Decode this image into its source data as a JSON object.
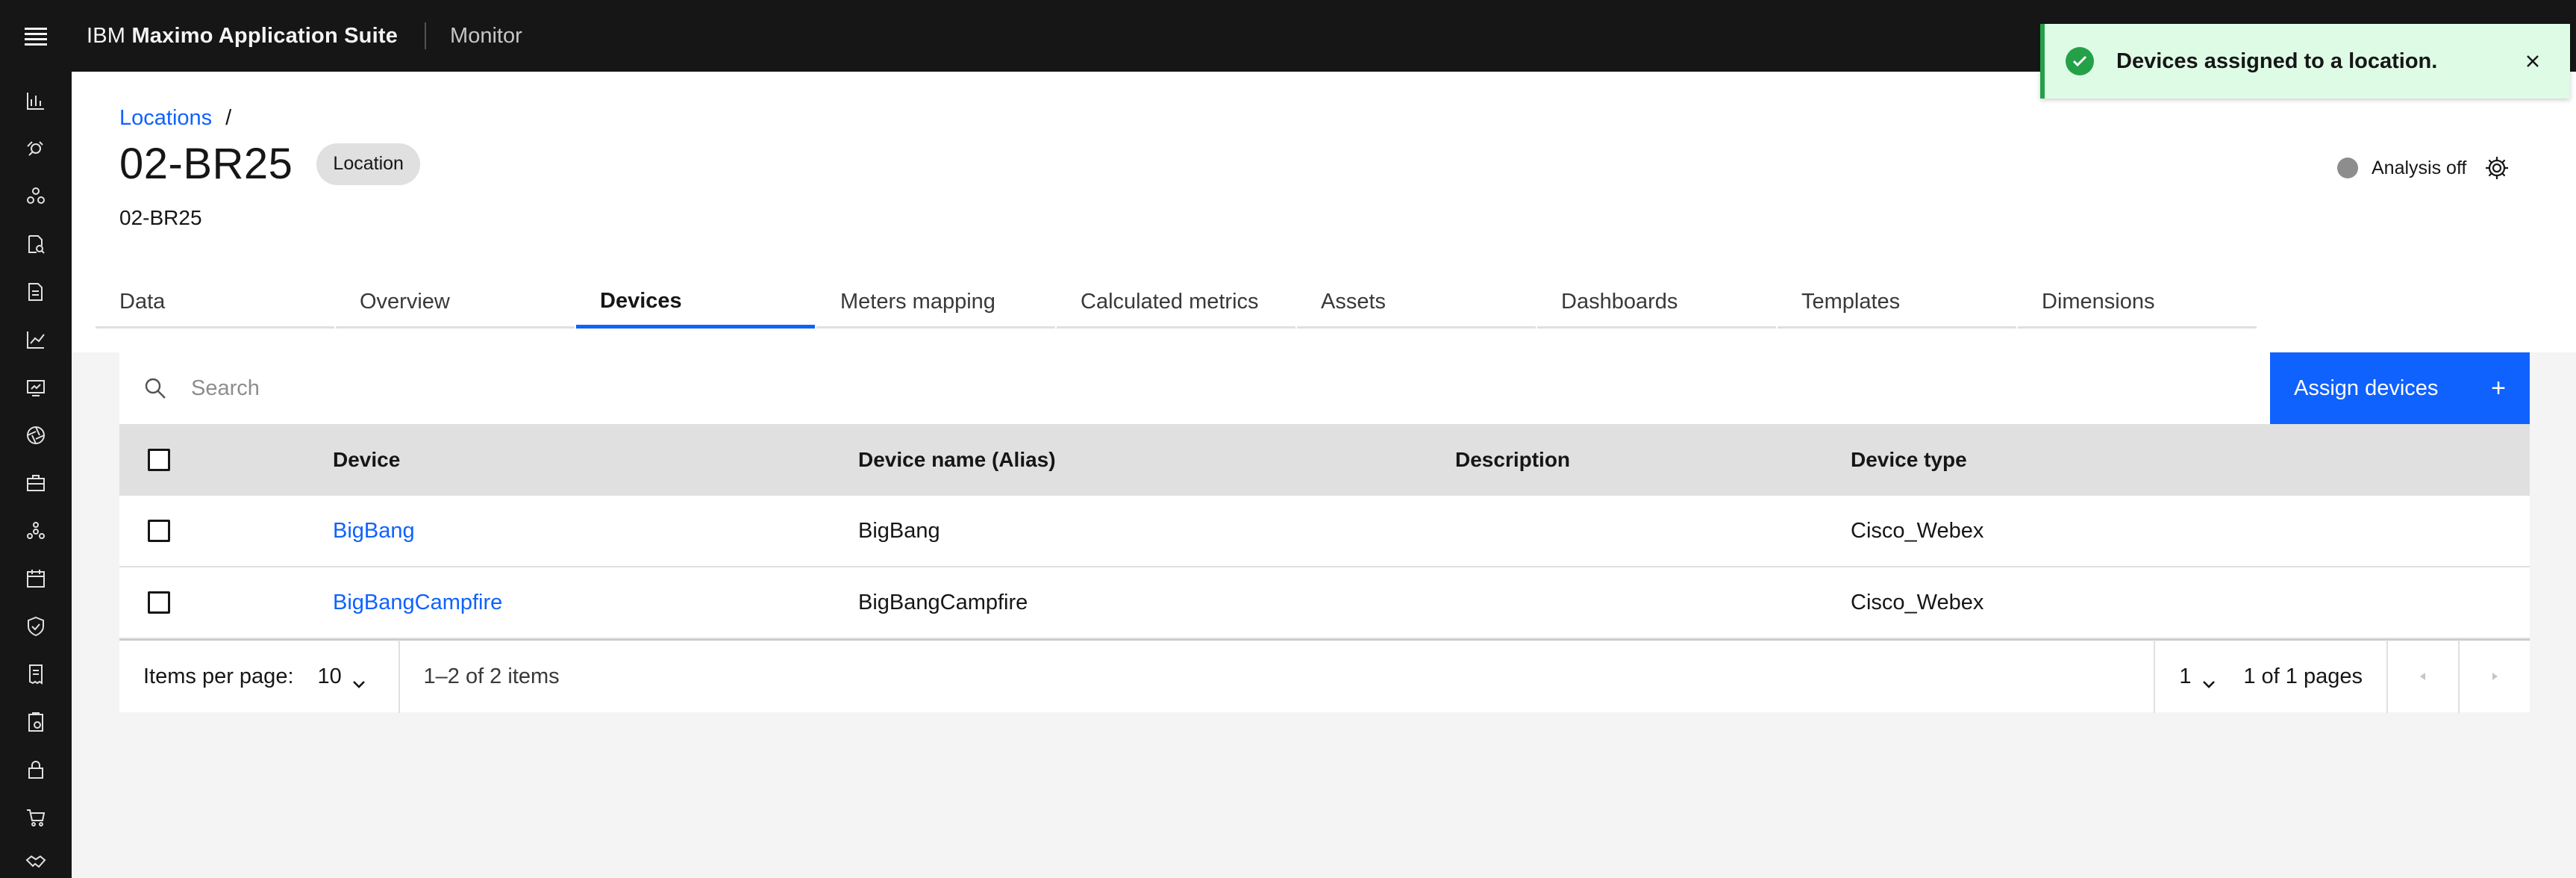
{
  "header": {
    "brand_prefix": "IBM",
    "brand_name": "Maximo Application Suite",
    "product": "Monitor"
  },
  "rail": {
    "icons": [
      "bar-chart-icon",
      "satellite-icon",
      "network-icon",
      "document-search-icon",
      "report-icon",
      "line-chart-icon",
      "screen-icon",
      "aperture-icon",
      "briefcase-icon",
      "hierarchy-icon",
      "calendar-icon",
      "shield-icon",
      "receipt-icon",
      "clipboard-icon",
      "lock-icon",
      "cart-icon",
      "handshake-icon"
    ]
  },
  "breadcrumb": {
    "link": "Locations",
    "separator": "/"
  },
  "page": {
    "title": "02-BR25",
    "tag": "Location",
    "subtitle": "02-BR25"
  },
  "analysis": {
    "label": "Analysis off"
  },
  "tabs": [
    {
      "label": "Data"
    },
    {
      "label": "Overview"
    },
    {
      "label": "Devices",
      "active": true
    },
    {
      "label": "Meters mapping"
    },
    {
      "label": "Calculated metrics"
    },
    {
      "label": "Assets"
    },
    {
      "label": "Dashboards"
    },
    {
      "label": "Templates"
    },
    {
      "label": "Dimensions"
    }
  ],
  "toolbar": {
    "search_placeholder": "Search",
    "assign_label": "Assign devices",
    "assign_icon": "+"
  },
  "table": {
    "headers": {
      "device": "Device",
      "alias": "Device name (Alias)",
      "description": "Description",
      "type": "Device type"
    },
    "rows": [
      {
        "device": "BigBang",
        "alias": "BigBang",
        "description": "",
        "type": "Cisco_Webex"
      },
      {
        "device": "BigBangCampfire",
        "alias": "BigBangCampfire",
        "description": "",
        "type": "Cisco_Webex"
      }
    ]
  },
  "pagination": {
    "ipp_label": "Items per page:",
    "ipp_value": "10",
    "range": "1–2 of 2 items",
    "page_value": "1",
    "pages_text": "1 of 1 pages"
  },
  "toast": {
    "message": "Devices assigned to a location.",
    "kind": "success"
  },
  "colors": {
    "primary": "#0f62fe",
    "header_bg": "#161616",
    "success": "#24a148",
    "toast_bg": "#defbe6"
  }
}
